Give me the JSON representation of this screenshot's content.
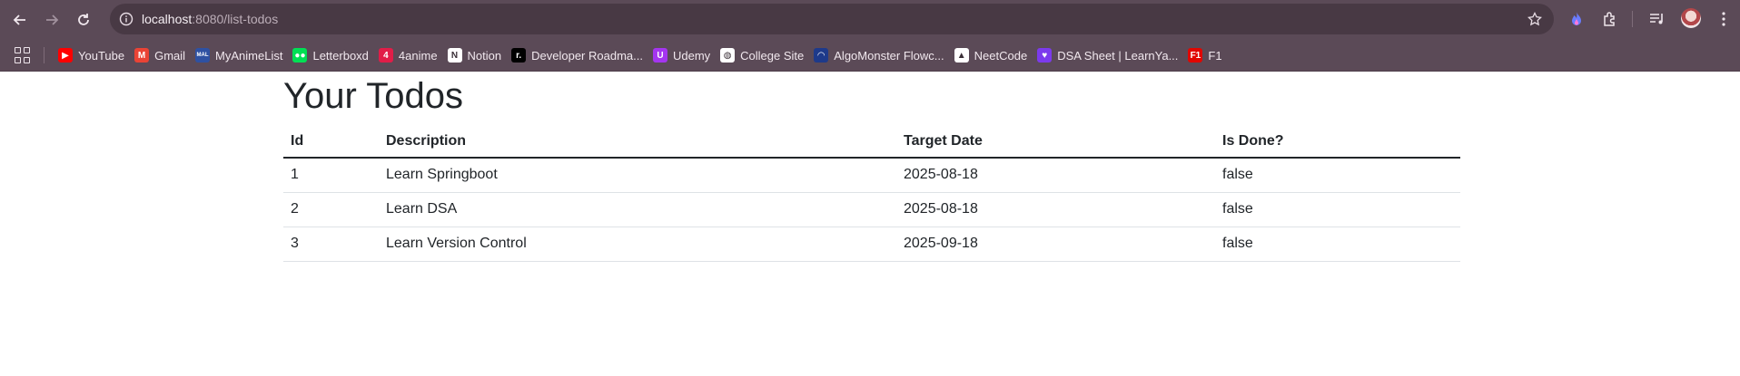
{
  "browser": {
    "url_host": "localhost",
    "url_rest": ":8080/list-todos",
    "bookmarks": [
      {
        "label": "YouTube",
        "icon": "youtube-icon",
        "color": "#ff0000"
      },
      {
        "label": "Gmail",
        "icon": "gmail-icon",
        "color": "#ea4335"
      },
      {
        "label": "MyAnimeList",
        "icon": "myanimelist-icon",
        "color": "#2e51a2"
      },
      {
        "label": "Letterboxd",
        "icon": "letterboxd-icon",
        "color": "#00e054"
      },
      {
        "label": "4anime",
        "icon": "4anime-icon",
        "color": "#e11d48"
      },
      {
        "label": "Notion",
        "icon": "notion-icon",
        "color": "#ffffff"
      },
      {
        "label": "Developer Roadma...",
        "icon": "roadmap-icon",
        "color": "#000000"
      },
      {
        "label": "Udemy",
        "icon": "udemy-icon",
        "color": "#a435f0"
      },
      {
        "label": "College Site",
        "icon": "globe-icon",
        "color": "#ffffff"
      },
      {
        "label": "AlgoMonster Flowc...",
        "icon": "algomonster-icon",
        "color": "#1e3a8a"
      },
      {
        "label": "NeetCode",
        "icon": "neetcode-icon",
        "color": "#ffffff"
      },
      {
        "label": "DSA Sheet | LearnYa...",
        "icon": "learnyard-icon",
        "color": "#7c3aed"
      },
      {
        "label": "F1",
        "icon": "f1-icon",
        "color": "#e10600"
      }
    ]
  },
  "page": {
    "title": "Your Todos",
    "table": {
      "headers": [
        "Id",
        "Description",
        "Target Date",
        "Is Done?"
      ],
      "rows": [
        [
          "1",
          "Learn Springboot",
          "2025-08-18",
          "false"
        ],
        [
          "2",
          "Learn DSA",
          "2025-08-18",
          "false"
        ],
        [
          "3",
          "Learn Version Control",
          "2025-09-18",
          "false"
        ]
      ]
    }
  }
}
